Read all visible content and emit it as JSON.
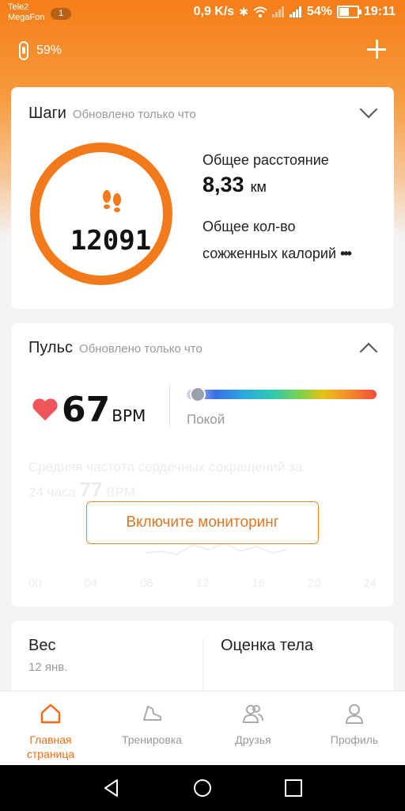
{
  "status_bar": {
    "carrier_1": "Tele2",
    "carrier_2": "MegaFon",
    "sim_badge": "1",
    "speed": "0,9 K/s",
    "battery_percent": "54%",
    "battery_level": 0.54,
    "time": "19:11"
  },
  "header": {
    "band_battery": "59%",
    "band_battery_level": 0.59
  },
  "steps_card": {
    "title": "Шаги",
    "updated": "Обновлено только что",
    "steps": "12091",
    "distance_label": "Общее расстояние",
    "distance_value": "8,33",
    "distance_unit": "км",
    "calories_label_1": "Общее кол-во",
    "calories_label_2": "сожженных калорий",
    "more": "•••"
  },
  "pulse_card": {
    "title": "Пульс",
    "updated": "Обновлено только что",
    "bpm_value": "67",
    "bpm_unit": "BPM",
    "zone_label": "Покой",
    "avg_label": "Средняя частота сердечных сокращений за",
    "avg_period": "24 часа",
    "avg_value": "77",
    "avg_unit": "BPM",
    "monitor_button": "Включите мониторинг",
    "hours": [
      "00",
      "04",
      "08",
      "12",
      "16",
      "20",
      "24"
    ]
  },
  "bottom_card": {
    "weight_title": "Вес",
    "weight_date": "12 янв.",
    "body_title": "Оценка тела"
  },
  "tabs": [
    {
      "label": "Главная\nстраница",
      "icon": "home-icon",
      "active": true
    },
    {
      "label": "Тренировка",
      "icon": "shoe-icon",
      "active": false
    },
    {
      "label": "Друзья",
      "icon": "friends-icon",
      "active": false
    },
    {
      "label": "Профиль",
      "icon": "profile-icon",
      "active": false
    }
  ],
  "colors": {
    "accent": "#f27a1a",
    "header_top": "#f57e18"
  }
}
